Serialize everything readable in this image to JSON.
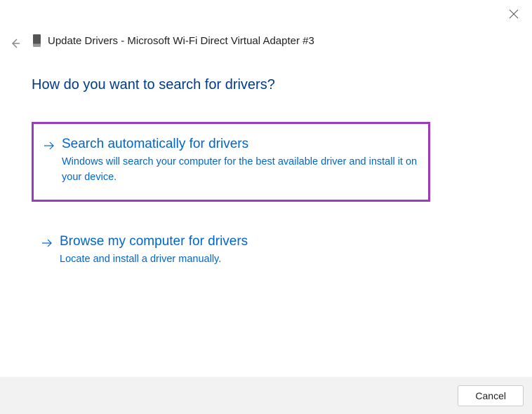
{
  "header": {
    "title": "Update Drivers - Microsoft Wi-Fi Direct Virtual Adapter #3"
  },
  "question": "How do you want to search for drivers?",
  "options": [
    {
      "title": "Search automatically for drivers",
      "description": "Windows will search your computer for the best available driver and install it on your device."
    },
    {
      "title": "Browse my computer for drivers",
      "description": "Locate and install a driver manually."
    }
  ],
  "footer": {
    "cancel_label": "Cancel"
  }
}
